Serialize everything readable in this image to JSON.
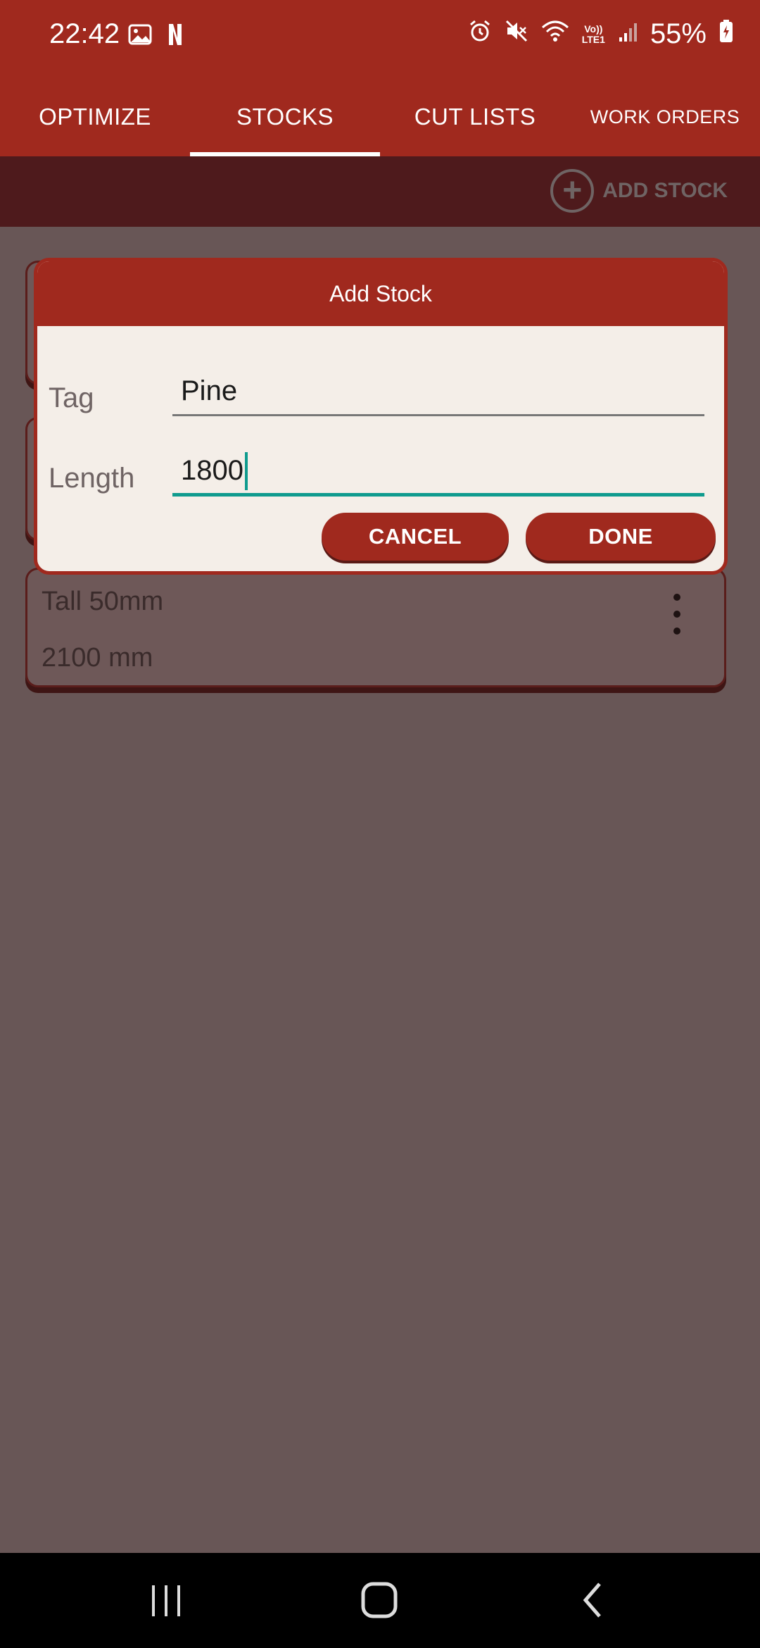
{
  "status_bar": {
    "time": "22:42",
    "battery": "55%",
    "icons_left": [
      "gallery-icon",
      "netflix-icon"
    ],
    "icons_right": [
      "alarm-icon",
      "mute-icon",
      "wifi-icon",
      "volte-icon",
      "signal-icon",
      "battery-icon"
    ],
    "volte_label_top": "Vo))",
    "volte_label_bottom": "LTE1"
  },
  "tabs": [
    {
      "label": "OPTIMIZE",
      "active": false
    },
    {
      "label": "STOCKS",
      "active": true
    },
    {
      "label": "CUT LISTS",
      "active": false
    },
    {
      "label": "WORK ORDERS",
      "active": false
    }
  ],
  "toolbar": {
    "add_stock_label": "ADD STOCK"
  },
  "stock_cards": [
    {
      "title": "Tall 50mm",
      "length": "2100 mm"
    }
  ],
  "dialog": {
    "title": "Add Stock",
    "tag_label": "Tag",
    "tag_value": "Pine",
    "length_label": "Length",
    "length_value": "1800",
    "cancel_label": "CANCEL",
    "done_label": "DONE"
  },
  "colors": {
    "primary": "#a0291e",
    "accent": "#0f9b8e",
    "scrim": "#685656"
  }
}
